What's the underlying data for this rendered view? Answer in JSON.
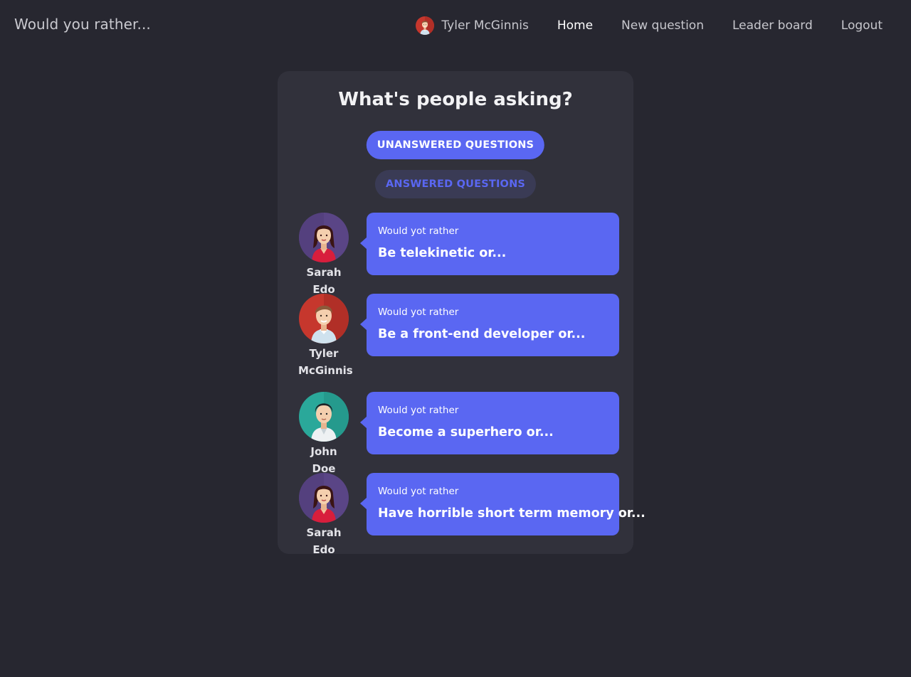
{
  "app": {
    "brand": "Would you rather..."
  },
  "nav": {
    "user_name": "Tyler McGinnis",
    "links": [
      {
        "label": "Home",
        "active": true
      },
      {
        "label": "New question",
        "active": false
      },
      {
        "label": "Leader board",
        "active": false
      },
      {
        "label": "Logout",
        "active": false
      }
    ]
  },
  "card": {
    "title": "What's people asking?",
    "tabs": {
      "unanswered": "UNANSWERED QUESTIONS",
      "answered": "ANSWERED QUESTIONS"
    },
    "questions": [
      {
        "author": "Sarah Edo",
        "avatar": "sarah-avatar",
        "prefix": "Would yot rather",
        "text": "Be telekinetic or..."
      },
      {
        "author": "Tyler McGinnis",
        "avatar": "tyler-avatar",
        "prefix": "Would yot rather",
        "text": "Be a front-end developer or..."
      },
      {
        "author": "John Doe",
        "avatar": "john-avatar",
        "prefix": "Would yot rather",
        "text": "Become a superhero or..."
      },
      {
        "author": "Sarah Edo",
        "avatar": "sarah-avatar",
        "prefix": "Would yot rather",
        "text": "Have horrible short term memory or..."
      }
    ]
  },
  "colors": {
    "background": "#272730",
    "card": "#31313b",
    "accent": "#5a67f2",
    "secondary_pill": "#3a3b55",
    "sarah_avatar_bg": "#5a4586",
    "tyler_avatar_bg": "#c6372d",
    "john_avatar_bg": "#2aa89a"
  }
}
